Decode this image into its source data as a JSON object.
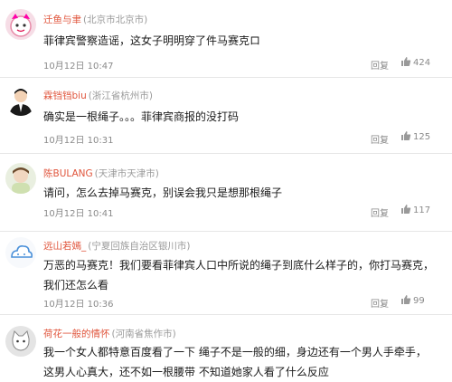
{
  "comments": [
    {
      "nick": "迁鱼与聿",
      "location": "(北京市北京市)",
      "text": "菲律宾警察造谣，这女子明明穿了件马赛克ロ",
      "time": "10月12日 10:47",
      "reply": "回复",
      "likes": "424",
      "avatar_icon": "pink-cartoon-avatar"
    },
    {
      "nick": "霖铛铛biu",
      "location": "(浙江省杭州市)",
      "text": "确实是一根绳子。。。菲律宾商报的没打码",
      "time": "10月12日 10:31",
      "reply": "回复",
      "likes": "125",
      "avatar_icon": "suited-man-avatar"
    },
    {
      "nick": "陈BULANG",
      "location": "(天津市天津市)",
      "text": "请问，怎么去掉马赛克，别误会我只是想那根绳子",
      "time": "10月12日 10:41",
      "reply": "回复",
      "likes": "117",
      "avatar_icon": "child-photo-avatar"
    },
    {
      "nick": "远山若嫣_",
      "location": "(宁夏回族自治区银川市)",
      "text": "万恶的马赛克！我们要看菲律宾人口中所说的绳子到底什么样子的，你打马赛克，我们还怎么看",
      "time": "10月12日 10:36",
      "reply": "回复",
      "likes": "99",
      "avatar_icon": "cloud-avatar"
    },
    {
      "nick": "荷花一般的情怀",
      "location": "(河南省焦作市)",
      "text": "我一个女人都特意百度看了一下 绳子不是一般的细，身边还有一个男人手牵手，这男人心真大，还不如一根腰带 不知道她家人看了什么反应",
      "time": "",
      "reply": "",
      "likes": "",
      "avatar_icon": "cat-avatar"
    }
  ]
}
